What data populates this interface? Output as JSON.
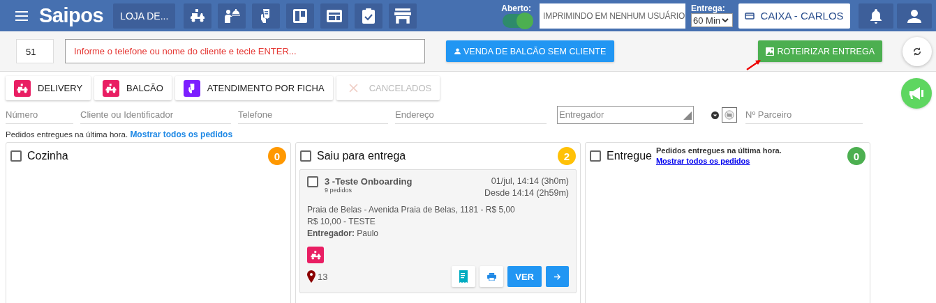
{
  "header": {
    "logo": "Saipos",
    "store": "LOJA DE...",
    "open_toggle": {
      "label": "Aberto:",
      "on": true
    },
    "printer": "IMPRIMINDO EM NENHUM USUÁRIO",
    "delivery_time": {
      "label": "Entrega:",
      "value": "60 Min"
    },
    "cashier": "CAIXA - CARLOS"
  },
  "toolbar": {
    "order_number": "51",
    "search": {
      "placeholder": "Informe o telefone ou nome do cliente e tecle ENTER..."
    },
    "counter_sale_button": "VENDA DE BALCÃO SEM CLIENTE",
    "route_button": "ROTEIRIZAR ENTREGA"
  },
  "order_types": [
    {
      "label": "DELIVERY",
      "kind": "delivery",
      "disabled": false
    },
    {
      "label": "BALCÃO",
      "kind": "counter",
      "disabled": false
    },
    {
      "label": "ATENDIMENTO POR FICHA",
      "kind": "ticket",
      "disabled": false
    },
    {
      "label": "CANCELADOS",
      "kind": "cancel",
      "disabled": true
    }
  ],
  "filters": [
    {
      "placeholder": "Número",
      "kind": "text"
    },
    {
      "placeholder": "Cliente ou Identificador",
      "kind": "text"
    },
    {
      "placeholder": "Telefone",
      "kind": "text"
    },
    {
      "placeholder": "Endereço",
      "kind": "text"
    },
    {
      "placeholder": "Entregador",
      "kind": "select"
    },
    {
      "placeholder": "Nº Parceiro",
      "kind": "partner"
    }
  ],
  "notice": {
    "text": "Pedidos entregues na última hora.",
    "link": "Mostrar todos os pedidos"
  },
  "columns": [
    {
      "title": "Cozinha",
      "checked": false,
      "count": "0",
      "color": "#ff9800"
    },
    {
      "title": "Saiu para entrega",
      "checked": false,
      "count": "2",
      "color": "#ffc107",
      "orders": [
        {
          "checked": false,
          "title": "3 -Teste Onboarding",
          "subtitle": "9 pedidos",
          "date": "01/jul, 14:14 (3h0m)",
          "since": "Desde 14:14 (2h59m)",
          "address": "Praia de Belas - Avenida Praia de Belas, 1181 - R$ 5,00",
          "value": "R$ 10,00 - TESTE",
          "courier": "**Entregador:** Paulo",
          "stops": "13",
          "view_button": "VER"
        }
      ]
    },
    {
      "title": "Entregue",
      "checked": false,
      "count": "0",
      "color": "#4caf50",
      "note": "Pedidos entregues na última hora.",
      "link": "Mostrar todos os pedidos"
    }
  ]
}
